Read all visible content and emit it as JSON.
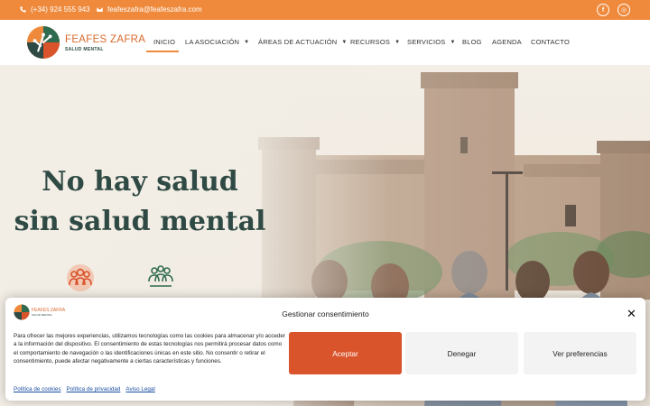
{
  "topbar": {
    "phone": "(+34) 924 555 943",
    "email": "feafeszafra@feafeszafra.com",
    "social": [
      "facebook-icon",
      "instagram-icon"
    ],
    "facebook_glyph": "f",
    "instagram_glyph": "◎"
  },
  "logo": {
    "title": "FEAFES ZAFRA",
    "subtitle": "SALUD MENTAL"
  },
  "nav": {
    "items": [
      {
        "label": "INICIO",
        "active": true
      },
      {
        "label": "LA ASOCIACIÓN",
        "dropdown": true
      },
      {
        "label": "ÁREAS DE ACTUACIÓN",
        "dropdown": true
      },
      {
        "label": "RECURSOS",
        "dropdown": true
      },
      {
        "label": "SERVICIOS",
        "dropdown": true
      },
      {
        "label": "BLOG"
      },
      {
        "label": "AGENDA"
      },
      {
        "label": "CONTACTO"
      }
    ]
  },
  "hero": {
    "line1": "No hay salud",
    "line2": "sin salud mental"
  },
  "cookie": {
    "logo_title": "FEAFES ZAFRA",
    "logo_subtitle": "SALUD MENTAL",
    "heading": "Gestionar consentimiento",
    "close": "✕",
    "text": "Para ofrecer las mejores experiencias, utilizamos tecnologías como las cookies para almacenar y/o acceder a la información del dispositivo. El consentimiento de estas tecnologías nos permitirá procesar datos como el comportamiento de navegación o las identificaciones únicas en este sitio. No consentir o retirar el consentimiento, puede afectar negativamente a ciertas características y funciones.",
    "accept": "Aceptar",
    "deny": "Denegar",
    "preferences": "Ver preferencias",
    "links": [
      "Política de cookies",
      "Política de privacidad",
      "Aviso Legal"
    ]
  },
  "colors": {
    "accent": "#ef8a3c",
    "primary_button": "#d9532b",
    "heading": "#2f4a44",
    "logo_text": "#d9682b"
  }
}
